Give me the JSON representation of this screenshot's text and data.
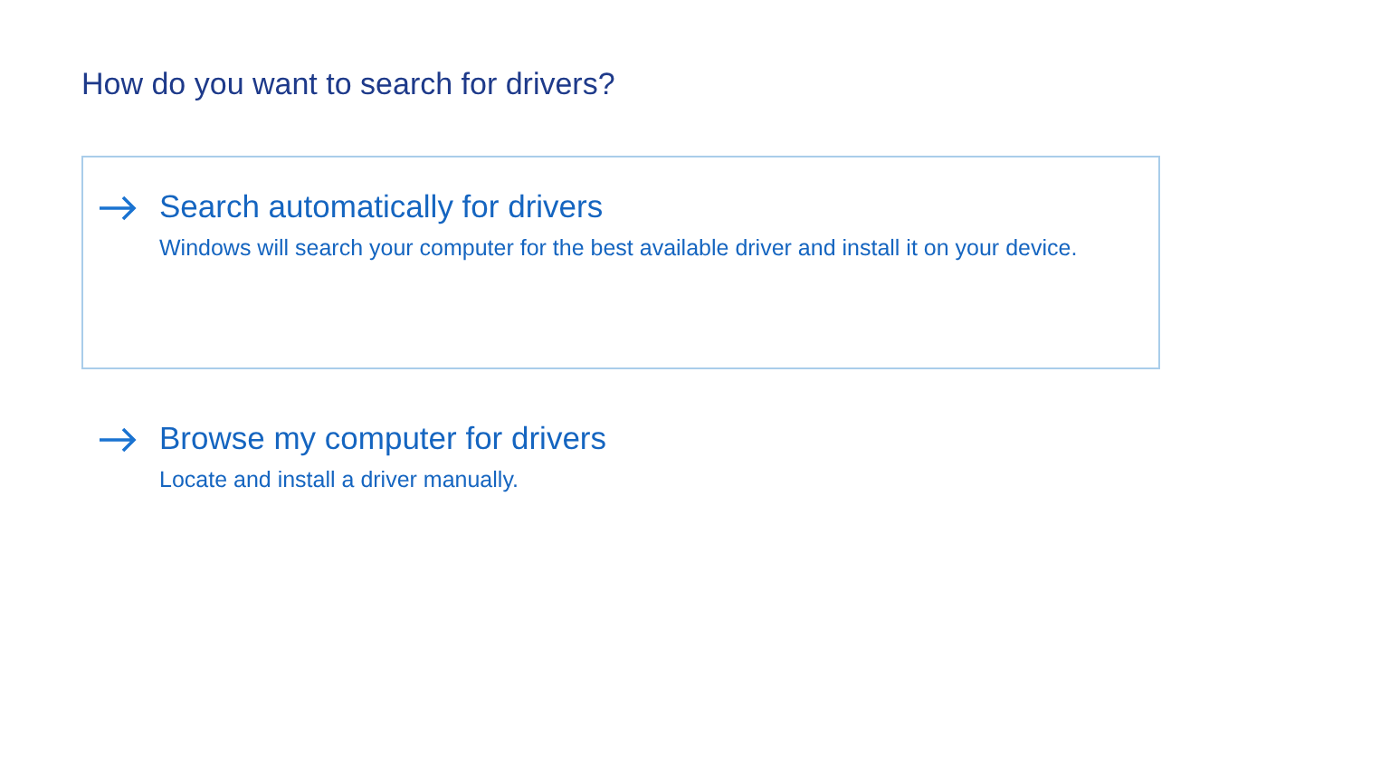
{
  "heading": "How do you want to search for drivers?",
  "options": [
    {
      "title": "Search automatically for drivers",
      "description": "Windows will search your computer for the best available driver and install it on your device.",
      "selected": true
    },
    {
      "title": "Browse my computer for drivers",
      "description": "Locate and install a driver manually.",
      "selected": false
    }
  ]
}
